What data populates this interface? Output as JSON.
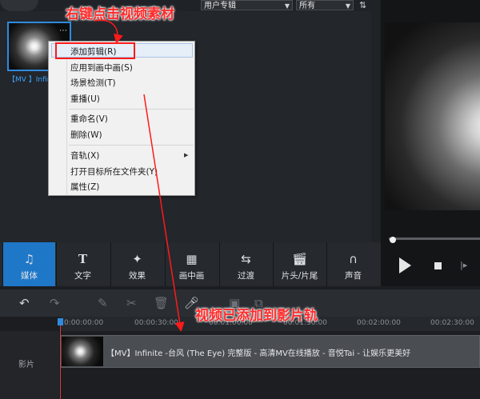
{
  "library": {
    "filter_album": "用户专辑",
    "filter_all": "所有",
    "sort_icon": "sort-icon",
    "thumb_label": "【MV 】Infinite"
  },
  "context_menu": {
    "items": [
      {
        "label": "添加剪辑(R)"
      },
      {
        "label": "应用到画中画(S)"
      },
      {
        "label": "场景检测(T)"
      },
      {
        "label": "重播(U)"
      },
      {
        "label": "重命名(V)"
      },
      {
        "label": "删除(W)"
      },
      {
        "label": "音轨(X)"
      },
      {
        "label": "打开目标所在文件夹(Y)"
      },
      {
        "label": "属性(Z)"
      }
    ]
  },
  "tools": [
    {
      "label": "媒体",
      "icon": "media-icon",
      "active": true
    },
    {
      "label": "文字",
      "icon": "text-icon"
    },
    {
      "label": "效果",
      "icon": "magic-wand-icon"
    },
    {
      "label": "画中画",
      "icon": "filmstrip-icon"
    },
    {
      "label": "过渡",
      "icon": "transition-icon"
    },
    {
      "label": "片头/片尾",
      "icon": "clapperboard-icon"
    },
    {
      "label": "声音",
      "icon": "headphones-icon"
    }
  ],
  "timeline": {
    "ticks": [
      "0:00:00:00",
      "00:00:30:00",
      "00:01:00:00",
      "00:01:30:00",
      "00:02:00:00",
      "00:02:30:00"
    ],
    "track_label": "影片",
    "clip_title": "【MV】Infinite -台风 (The Eye) 完整版 - 高清MV在线播放 - 音悦Tai - 让娱乐更美好"
  },
  "annotations": {
    "right_click": "右键点击视频素材",
    "added": "视频已添加到影片轨"
  },
  "colors": {
    "accent": "#1f77c8",
    "annotation": "#ff2a2a"
  }
}
